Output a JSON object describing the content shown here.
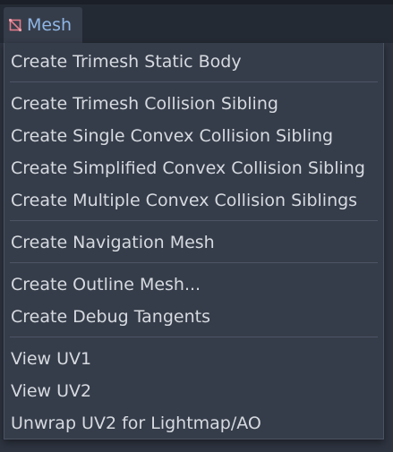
{
  "toolbar": {
    "mesh_menu_label": "Mesh",
    "mesh_icon": "mesh-icon"
  },
  "menu": {
    "items": [
      {
        "label": "Create Trimesh Static Body"
      },
      {
        "label": "Create Trimesh Collision Sibling"
      },
      {
        "label": "Create Single Convex Collision Sibling"
      },
      {
        "label": "Create Simplified Convex Collision Sibling"
      },
      {
        "label": "Create Multiple Convex Collision Siblings"
      },
      {
        "label": "Create Navigation Mesh"
      },
      {
        "label": "Create Outline Mesh..."
      },
      {
        "label": "Create Debug Tangents"
      },
      {
        "label": "View UV1"
      },
      {
        "label": "View UV2"
      },
      {
        "label": "Unwrap UV2 for Lightmap/AO"
      }
    ]
  },
  "colors": {
    "menu_bg": "#363d4a",
    "toolbar_bg": "#242a34",
    "accent_text": "#8fb6e6",
    "item_text": "#d6dae0",
    "separator": "#4d5566"
  }
}
